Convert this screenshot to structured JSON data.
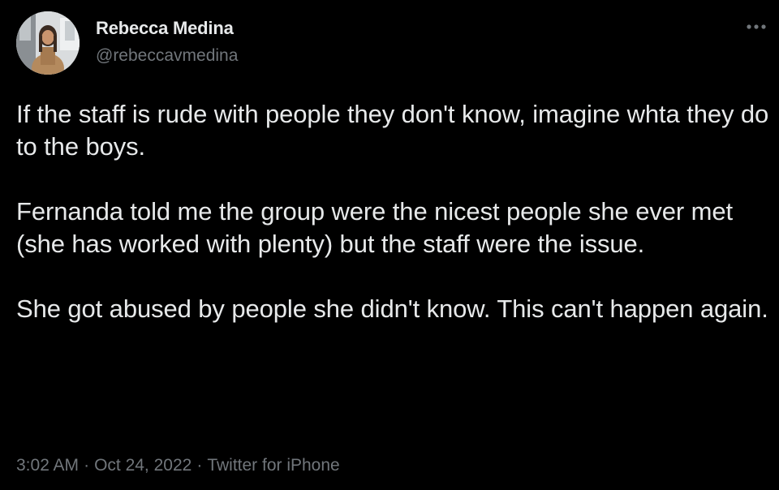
{
  "author": {
    "name": "Rebecca Medina",
    "handle": "@rebeccavmedina",
    "avatar_icon": "profile-photo-avatar"
  },
  "menu": {
    "more_icon": "more-horizontal-icon"
  },
  "tweet": {
    "paragraphs": [
      "If the staff is rude with people they don't know, imagine whta they do to the boys.",
      "Fernanda told me the group were the nicest people she ever met (she has worked with plenty) but the staff were the issue.",
      "She got abused by people she didn't know. This can't happen again."
    ]
  },
  "meta": {
    "time": "3:02 AM",
    "separator": "·",
    "date": "Oct 24, 2022",
    "source": "Twitter for iPhone"
  },
  "colors": {
    "background": "#000000",
    "primary_text": "#e7e9ea",
    "secondary_text": "#71767b"
  }
}
